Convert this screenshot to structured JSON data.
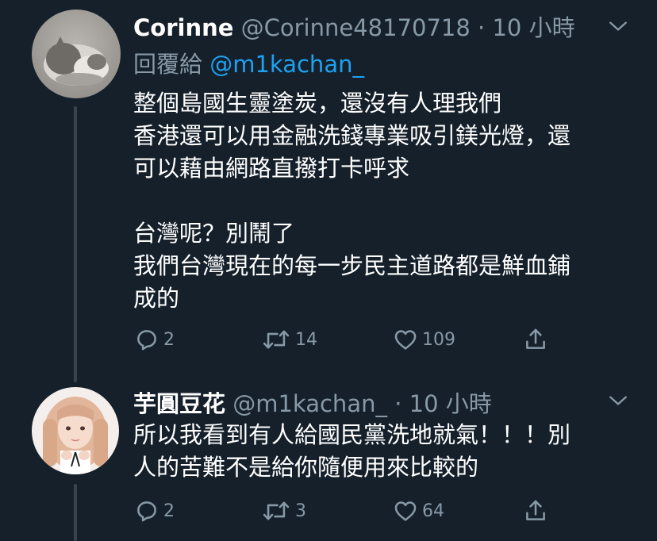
{
  "tweets": [
    {
      "display_name": "Corinne",
      "handle": "@Corinne48170718",
      "separator": "·",
      "time": "10 小時",
      "reply_label": "回覆給",
      "reply_mention": "@m1kachan_",
      "avatar_icon": "cat-avatar-icon",
      "body_lines": [
        "整個島國生靈塗炭，還沒有人理我們",
        "香港還可以用金融洗錢專業吸引鎂光燈，還",
        "可以藉由網路直撥打卡呼求",
        "",
        "台灣呢？別鬧了",
        "我們台灣現在的每一步民主道路都是鮮血鋪",
        "成的"
      ],
      "reply_count": "2",
      "retweet_count": "14",
      "like_count": "109"
    },
    {
      "display_name": "芋圓豆花",
      "handle": "@m1kachan_",
      "separator": "·",
      "time": "10 小時",
      "avatar_icon": "girl-avatar-icon",
      "body_lines": [
        "所以我看到有人給國民黨洗地就氣！！！別",
        "人的苦難不是給你隨便用來比較的"
      ],
      "reply_count": "2",
      "retweet_count": "3",
      "like_count": "64"
    }
  ],
  "colors": {
    "background": "#15202b",
    "primary_text": "#ffffff",
    "secondary_text": "#8899a6",
    "accent": "#1da1f2",
    "thread_line": "#38444d"
  }
}
